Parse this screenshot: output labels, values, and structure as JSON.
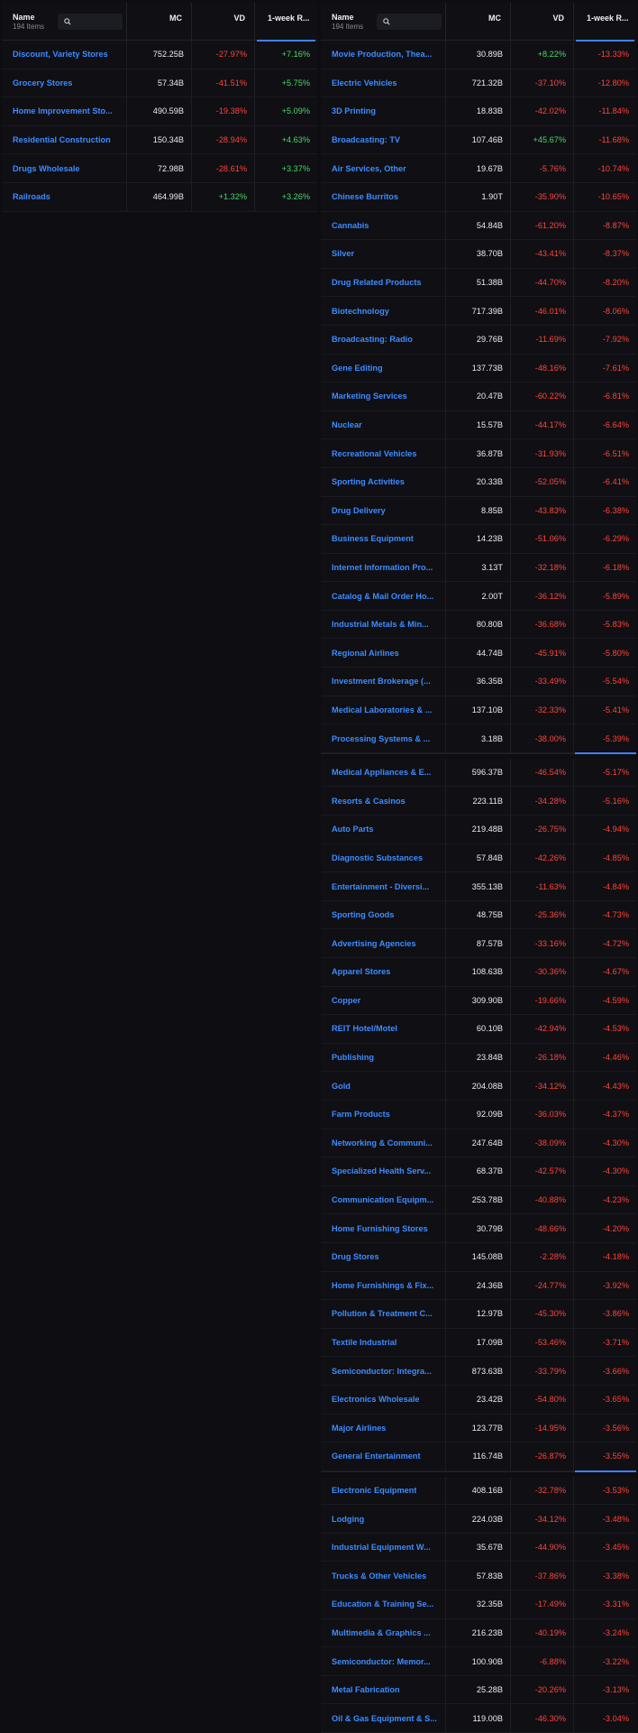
{
  "left": {
    "header": {
      "name": "Name",
      "count": "194 Items",
      "mc": "MC",
      "vd": "VD",
      "wk": "1-week R..."
    },
    "rows": [
      {
        "name": "Discount, Variety Stores",
        "mc": "752.25B",
        "vd": "-27.97%",
        "wk": "+7.16%"
      },
      {
        "name": "Grocery Stores",
        "mc": "57.34B",
        "vd": "-41.51%",
        "wk": "+5.75%"
      },
      {
        "name": "Home Improvement Sto...",
        "mc": "490.59B",
        "vd": "-19.38%",
        "wk": "+5.09%"
      },
      {
        "name": "Residential Construction",
        "mc": "150.34B",
        "vd": "-28.94%",
        "wk": "+4.63%"
      },
      {
        "name": "Drugs Wholesale",
        "mc": "72.98B",
        "vd": "-28.61%",
        "wk": "+3.37%"
      },
      {
        "name": "Railroads",
        "mc": "464.99B",
        "vd": "+1.32%",
        "wk": "+3.26%"
      }
    ]
  },
  "right": {
    "header": {
      "name": "Name",
      "count": "194 Items",
      "mc": "MC",
      "vd": "VD",
      "wk": "1-week R..."
    },
    "groups": [
      [
        {
          "name": "Movie Production, Thea...",
          "mc": "30.89B",
          "vd": "+8.22%",
          "wk": "-13.33%"
        },
        {
          "name": "Electric Vehicles",
          "mc": "721.32B",
          "vd": "-37.10%",
          "wk": "-12.80%"
        },
        {
          "name": "3D Printing",
          "mc": "18.83B",
          "vd": "-42.02%",
          "wk": "-11.84%"
        },
        {
          "name": "Broadcasting: TV",
          "mc": "107.46B",
          "vd": "+45.67%",
          "wk": "-11.68%"
        },
        {
          "name": "Air Services, Other",
          "mc": "19.67B",
          "vd": "-5.76%",
          "wk": "-10.74%"
        },
        {
          "name": "Chinese Burritos",
          "mc": "1.90T",
          "vd": "-35.90%",
          "wk": "-10.65%"
        },
        {
          "name": "Cannabis",
          "mc": "54.84B",
          "vd": "-61.20%",
          "wk": "-8.87%"
        },
        {
          "name": "Silver",
          "mc": "38.70B",
          "vd": "-43.41%",
          "wk": "-8.37%"
        },
        {
          "name": "Drug Related Products",
          "mc": "51.38B",
          "vd": "-44.70%",
          "wk": "-8.20%"
        },
        {
          "name": "Biotechnology",
          "mc": "717.39B",
          "vd": "-46.01%",
          "wk": "-8.06%"
        },
        {
          "name": "Broadcasting: Radio",
          "mc": "29.76B",
          "vd": "-11.69%",
          "wk": "-7.92%"
        },
        {
          "name": "Gene Editing",
          "mc": "137.73B",
          "vd": "-48.16%",
          "wk": "-7.61%"
        },
        {
          "name": "Marketing Services",
          "mc": "20.47B",
          "vd": "-60.22%",
          "wk": "-6.81%"
        },
        {
          "name": "Nuclear",
          "mc": "15.57B",
          "vd": "-44.17%",
          "wk": "-6.64%"
        },
        {
          "name": "Recreational Vehicles",
          "mc": "36.87B",
          "vd": "-31.93%",
          "wk": "-6.51%"
        },
        {
          "name": "Sporting Activities",
          "mc": "20.33B",
          "vd": "-52.05%",
          "wk": "-6.41%"
        },
        {
          "name": "Drug Delivery",
          "mc": "8.85B",
          "vd": "-43.83%",
          "wk": "-6.38%"
        },
        {
          "name": "Business Equipment",
          "mc": "14.23B",
          "vd": "-51.06%",
          "wk": "-6.29%"
        },
        {
          "name": "Internet Information Pro...",
          "mc": "3.13T",
          "vd": "-32.18%",
          "wk": "-6.18%"
        },
        {
          "name": "Catalog & Mail Order Ho...",
          "mc": "2.00T",
          "vd": "-36.12%",
          "wk": "-5.89%"
        },
        {
          "name": "Industrial Metals & Min...",
          "mc": "80.80B",
          "vd": "-36.68%",
          "wk": "-5.83%"
        },
        {
          "name": "Regional Airlines",
          "mc": "44.74B",
          "vd": "-45.91%",
          "wk": "-5.80%"
        },
        {
          "name": "Investment Brokerage (...",
          "mc": "36.35B",
          "vd": "-33.49%",
          "wk": "-5.54%"
        },
        {
          "name": "Medical Laboratories & ...",
          "mc": "137.10B",
          "vd": "-32.33%",
          "wk": "-5.41%"
        },
        {
          "name": "Processing Systems & ...",
          "mc": "3.18B",
          "vd": "-38.00%",
          "wk": "-5.39%"
        }
      ],
      [
        {
          "name": "Medical Appliances & E...",
          "mc": "596.37B",
          "vd": "-46.54%",
          "wk": "-5.17%"
        },
        {
          "name": "Resorts & Casinos",
          "mc": "223.11B",
          "vd": "-34.28%",
          "wk": "-5.16%"
        },
        {
          "name": "Auto Parts",
          "mc": "219.48B",
          "vd": "-26.75%",
          "wk": "-4.94%"
        },
        {
          "name": "Diagnostic Substances",
          "mc": "57.84B",
          "vd": "-42.26%",
          "wk": "-4.85%"
        },
        {
          "name": "Entertainment - Diversi...",
          "mc": "355.13B",
          "vd": "-11.63%",
          "wk": "-4.84%"
        },
        {
          "name": "Sporting Goods",
          "mc": "48.75B",
          "vd": "-25.36%",
          "wk": "-4.73%"
        },
        {
          "name": "Advertising Agencies",
          "mc": "87.57B",
          "vd": "-33.16%",
          "wk": "-4.72%"
        },
        {
          "name": "Apparel Stores",
          "mc": "108.63B",
          "vd": "-30.36%",
          "wk": "-4.67%"
        },
        {
          "name": "Copper",
          "mc": "309.90B",
          "vd": "-19.66%",
          "wk": "-4.59%"
        },
        {
          "name": "REIT Hotel/Motel",
          "mc": "60.10B",
          "vd": "-42.94%",
          "wk": "-4.53%"
        },
        {
          "name": "Publishing",
          "mc": "23.84B",
          "vd": "-26.18%",
          "wk": "-4.46%"
        },
        {
          "name": "Gold",
          "mc": "204.08B",
          "vd": "-34.12%",
          "wk": "-4.43%"
        },
        {
          "name": "Farm Products",
          "mc": "92.09B",
          "vd": "-36.03%",
          "wk": "-4.37%"
        },
        {
          "name": "Networking & Communi...",
          "mc": "247.64B",
          "vd": "-38.09%",
          "wk": "-4.30%"
        },
        {
          "name": "Specialized Health Serv...",
          "mc": "68.37B",
          "vd": "-42.57%",
          "wk": "-4.30%"
        },
        {
          "name": "Communication Equipm...",
          "mc": "253.78B",
          "vd": "-40.88%",
          "wk": "-4.23%"
        },
        {
          "name": "Home Furnishing Stores",
          "mc": "30.79B",
          "vd": "-48.66%",
          "wk": "-4.20%"
        },
        {
          "name": "Drug Stores",
          "mc": "145.08B",
          "vd": "-2.28%",
          "wk": "-4.18%"
        },
        {
          "name": "Home Furnishings & Fix...",
          "mc": "24.36B",
          "vd": "-24.77%",
          "wk": "-3.92%"
        },
        {
          "name": "Pollution & Treatment C...",
          "mc": "12.97B",
          "vd": "-45.30%",
          "wk": "-3.86%"
        },
        {
          "name": "Textile Industrial",
          "mc": "17.09B",
          "vd": "-53.46%",
          "wk": "-3.71%"
        },
        {
          "name": "Semiconductor: Integra...",
          "mc": "873.63B",
          "vd": "-33.79%",
          "wk": "-3.66%"
        },
        {
          "name": "Electronics Wholesale",
          "mc": "23.42B",
          "vd": "-54.80%",
          "wk": "-3.65%"
        },
        {
          "name": "Major Airlines",
          "mc": "123.77B",
          "vd": "-14.95%",
          "wk": "-3.56%"
        },
        {
          "name": "General Entertainment",
          "mc": "116.74B",
          "vd": "-26.87%",
          "wk": "-3.55%"
        }
      ],
      [
        {
          "name": "Electronic Equipment",
          "mc": "408.16B",
          "vd": "-32.78%",
          "wk": "-3.53%"
        },
        {
          "name": "Lodging",
          "mc": "224.03B",
          "vd": "-34.12%",
          "wk": "-3.48%"
        },
        {
          "name": "Industrial Equipment W...",
          "mc": "35.67B",
          "vd": "-44.90%",
          "wk": "-3.45%"
        },
        {
          "name": "Trucks & Other Vehicles",
          "mc": "57.83B",
          "vd": "-37.86%",
          "wk": "-3.38%"
        },
        {
          "name": "Education & Training Se...",
          "mc": "32.35B",
          "vd": "-17.49%",
          "wk": "-3.31%"
        },
        {
          "name": "Multimedia & Graphics ...",
          "mc": "216.23B",
          "vd": "-40.19%",
          "wk": "-3.24%"
        },
        {
          "name": "Semiconductor: Memor...",
          "mc": "100.90B",
          "vd": "-6.88%",
          "wk": "-3.22%"
        },
        {
          "name": "Metal Fabrication",
          "mc": "25.28B",
          "vd": "-20.26%",
          "wk": "-3.13%"
        },
        {
          "name": "Oil & Gas Equipment & S...",
          "mc": "119.00B",
          "vd": "-46.30%",
          "wk": "-3.04%"
        }
      ]
    ]
  }
}
